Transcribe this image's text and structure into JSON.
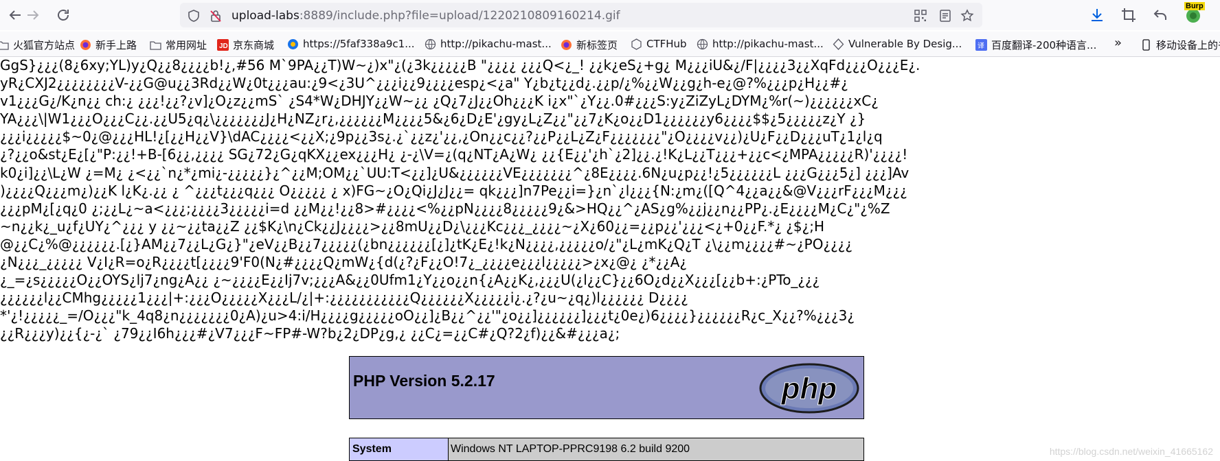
{
  "browser": {
    "url_host": "upload-labs",
    "url_rest": ":8889/include.php?file=upload/1220210809160214.gif",
    "burp_label": "Burp"
  },
  "bookmarks": [
    {
      "label": "火狐官方站点"
    },
    {
      "label": "新手上路"
    },
    {
      "label": "常用网址"
    },
    {
      "label": "京东商城"
    },
    {
      "label": "https://5faf338a9c1..."
    },
    {
      "label": "http://pikachu-mast..."
    },
    {
      "label": "新标签页"
    },
    {
      "label": "CTFHub"
    },
    {
      "label": "http://pikachu-mast..."
    },
    {
      "label": "Vulnerable By Desig..."
    },
    {
      "label": "百度翻译-200种语言..."
    },
    {
      "label": "移动设备上的书"
    }
  ],
  "garbled_output": [
    "GgS}¿¿¿(8¿6xy;YL)y¿Q¿¿8¿¿¿¿b!¿,#56 M`9PA¿¿T)W~¿)x\"¿(¿3k¿¿¿¿¿B \"¿¿¿¿ ¿¿¿Q<¿_! ¿¿k¿eS¿+g¿ M¿¿¿iU&¿/F|¿¿¿¿3¿¿XqFd¿¿¿O¿¿¿E¿.",
    "yR¿CXJ2¿¿¿¿¿¿¿¿V-¿¿G@u¿¿3Rd¿¿W¿0t¿¿¿au:¿9<¿3U^¿¿¿i¿¿9¿¿¿¿esp¿<¿a\" Y¿b¿t¿¿d¿.¿¿p/¿%¿¿W¿¿g¿h-e¿@?%¿¿¿p¿H¿¿#¿",
    "v1¿¿¿G¿/K¿n¿¿ ch:¿ ¿¿¿!¿¿?¿v]¿O¿z¿¿mS` ¿S4*W¿DHJY¿¿W~¿¿ ¿Q¿7¿J¿¿Oh¿¿¿K i¿x\"`¿Y¿¿.0#¿¿¿S:y¿ZiZyL¿DYM¿%r(~)¿¿¿¿¿¿xC¿",
    "YA¿¿¿\\|W1¿¿¿O¿¿¿C¿¿.¿¿U5¿q¿\\¿¿¿¿¿¿¿J¿H¿NZ¿r¿,¿¿¿¿¿¿M¿¿¿¿5&¿6¿D¿E'¿gy¿L¿Z¿¿\"¿¿7¿K¿o¿¿D1¿¿¿¿¿¿y6¿¿¿¿$$¿5¿¿¿¿¿z¿Y ¿}",
    "¿¿¿i¿¿¿¿¿$~0¿@¿¿¿HL!¿[¿¿H¿¿V}\\dAC¿¿¿¿<¿¿X;¿9p¿¿3s¿.¿`¿¿z¿'¿¿,¿On¿¿c¿¿?¿¿P¿¿L¿Z¿F¿¿¿¿¿¿¿\"¿O¿¿¿¿v¿¿)¿U¿F¿¿D¿¿¿uT¿1¿l¿q",
    "¿?¿¿o&st¿E¿[¿\"P:¿¿!+B-[6¿¿,¿¿¿¿ SG¿72¿G¿qKX¿¿ex¿¿¿H¿ ¿-¿\\V=¿(q¿NT¿A¿W¿ ¿¿{E¿¿'¿h`¿2]¿¿.¿!K¿L¿¿T¿¿¿+¿¿c<¿MPA¿¿¿¿¿R)'¿¿¿¿!",
    "k0¿i]¿¿\\L¿W ¿=M¿ ¿<¿¿`n¿*¿mi¿-¿¿¿¿¿}¿^¿¿M;OM¿¿`UU:T<¿¿]¿U&¿¿¿¿¿¿VE¿¿¿¿¿¿¿^¿8E¿¿¿¿.6N¿u¿p¿¿!¿5¿¿¿¿¿¿L ¿¿¿G¿¿¿5¿] ¿¿¿]Av",
    ")¿¿¿¿Q¿¿¿m¿)¿¿K l¿K¿.¿¿ ¿ ^¿¿¿t¿¿¿q¿¿¿ O¿¿¿¿¿ ¿ x)FG~¿O¿Qi¿J¿J¿¿= qk¿¿¿]n7Pe¿¿i=}¿n`¿l¿¿¿{N:¿m¿([Q^4¿¿a¿¿&@V¿¿¿rF¿¿¿M¿¿¿",
    "¿¿¿pM¿[¿q¿0 ¿;¿¿L¿~a<¿¿¿;¿¿¿¿3¿¿¿¿¿i=d ¿¿M¿¿!¿¿8>#¿¿¿¿<%¿¿pN¿¿¿¿8¿¿¿¿¿9¿&>HQ¿¿^¿AS¿g%¿¿j¿¿n¿¿PP¿.¿E¿¿¿¿M¿C¿\"¿%Z",
    "~n¿¿k¿_u¿f¿UY¿^¿¿¿ y ¿¿~¿¿ta¿¿Z ¿¿$K¿\\n¿Ck¿¿J¿¿¿¿>¿¿8mU¿¿D¿\\¿¿¿Kc¿¿¿_¿¿¿¿~¿X¿60¿¿=¿¿p¿¿'¿¿¿<¿+0¿¿F.*¿ ¿$¿;H",
    "@¿¿C¿%@¿¿¿¿¿¿.[¿}AM¿¿7¿¿L¿G¿}\"¿eV¿¿B¿¿7¿¿¿¿¿(¿bn¿¿¿¿¿¿[¿]¿tK¿E¿!k¿N¿¿¿¿,¿¿¿¿¿o/¿\"¿L¿mK¿Q¿T ¿\\¿¿m¿¿¿¿#~¿PO¿¿¿¿",
    "¿N¿¿¿_¿¿¿¿¿ V¿I¿R=o¿R¿¿¿¿t[¿¿¿¿9'F0(N¿#¿¿¿¿Q¿mW¿{d(¿?¿F¿¿O!7¿_¿¿¿¿e¿¿¿l¿¿¿¿¿>¿x¿@¿ ¿*¿¿A¿",
    "¿_=¿s¿¿¿¿¿O¿¿OYS¿lj7¿ng¿A¿¿ ¿~¿¿¿¿E¿¿Ij7v;¿¿¿A&¿¿0Ufm1¿Y¿¿o¿¿n{¿A¿¿K¿,¿¿¿U(¿l¿¿C}¿¿6O¿d¿¿X¿¿¿[¿¿b+:¿PTo_¿¿¿",
    "¿¿¿¿¿¿l¿¿CMhg¿¿¿¿¿1¿¿¿|+:¿¿¿O¿¿¿¿¿X¿¿¿L/¿|+:¿¿¿¿¿¿¿¿¿¿¿Q¿¿¿¿¿¿X¿¿¿¿¿i¿.¿?¿u~¿q¿)l¿¿¿¿¿¿ D¿¿¿¿",
    "*'¿!¿¿¿¿¿_=/O¿¿¿\"k_4q8¿n¿¿¿¿¿¿¿0¿A)¿u>4:i/H¿¿¿¿g¿¿¿¿¿oO¿¿]¿B¿¿^¿¿'\"¿o¿¿]¿¿¿¿¿¿]¿¿¿t¿0e¿)6¿¿¿¿}¿¿¿¿¿¿R¿c_X¿¿?%¿¿¿3¿",
    "¿¿R¿¿¿y)¿¿{¿-¿` ¿79¿¿I6h¿¿¿#¿V7¿¿¿F~FP#-W?b¿2¿DP¿g,¿ ¿¿C¿=¿¿C#¿Q?2¿f)¿¿&#¿¿¿a¿;"
  ],
  "phpinfo": {
    "title": "PHP Version 5.2.17",
    "logo_text": "php",
    "system_label": "System",
    "system_value": "Windows NT LAPTOP-PPRC9198 6.2 build 9200"
  },
  "watermark": "https://blog.csdn.net/weixin_41665162"
}
